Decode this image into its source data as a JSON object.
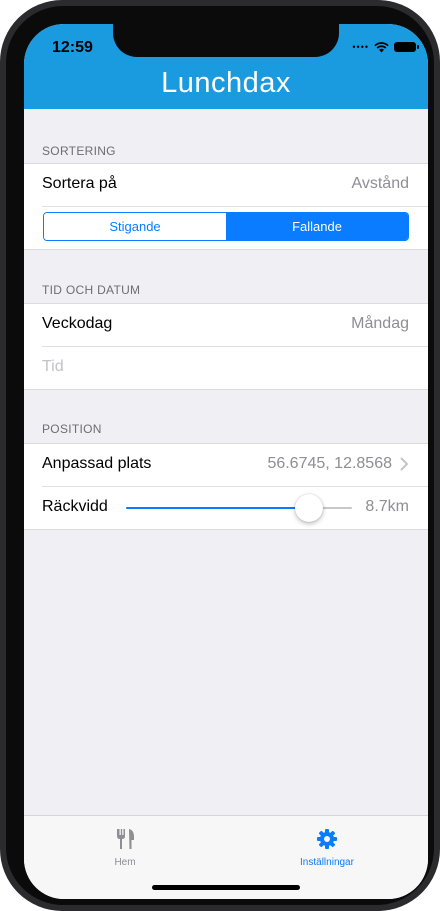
{
  "status": {
    "time": "12:59"
  },
  "header": {
    "title": "Lunchdax"
  },
  "sorting": {
    "section_title": "SORTERING",
    "sort_on_label": "Sortera på",
    "sort_on_value": "Avstånd",
    "segments": [
      "Stigande",
      "Fallande"
    ],
    "selected_segment": "Fallande"
  },
  "time_date": {
    "section_title": "TID OCH DATUM",
    "weekday_label": "Veckodag",
    "weekday_value": "Måndag",
    "time_placeholder": "Tid"
  },
  "position": {
    "section_title": "POSITION",
    "custom_place_label": "Anpassad plats",
    "custom_place_value": "56.6745, 12.8568",
    "range_label": "Räckvidd",
    "range_value": "8.7km",
    "range_fraction": 0.81
  },
  "tabbar": {
    "items": [
      {
        "label": "Hem",
        "icon": "fork-knife-icon",
        "active": false
      },
      {
        "label": "Inställningar",
        "icon": "gear-icon",
        "active": true
      }
    ]
  },
  "colors": {
    "header": "#1a9be0",
    "accent": "#0a7cff",
    "inactive": "#8e8e93"
  }
}
